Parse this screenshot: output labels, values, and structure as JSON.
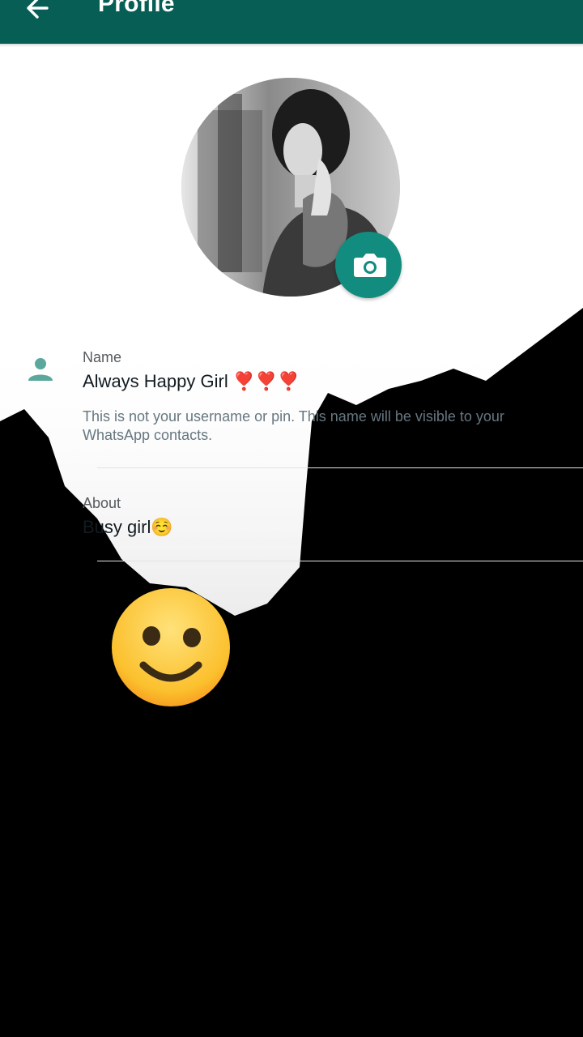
{
  "header": {
    "title": "Profile",
    "back_icon": "arrow-back-icon"
  },
  "profile": {
    "camera_icon": "camera-icon",
    "name": {
      "label": "Name",
      "value": "Always Happy Girl ❣️❣️❣️",
      "helper": "This is not your username or pin. This name will be visible to your WhatsApp contacts."
    },
    "about": {
      "label": "About",
      "value": "Busy girl☺️"
    }
  },
  "colors": {
    "appbar": "#075e54",
    "accent": "#128c7e",
    "overlay": "#000000"
  }
}
